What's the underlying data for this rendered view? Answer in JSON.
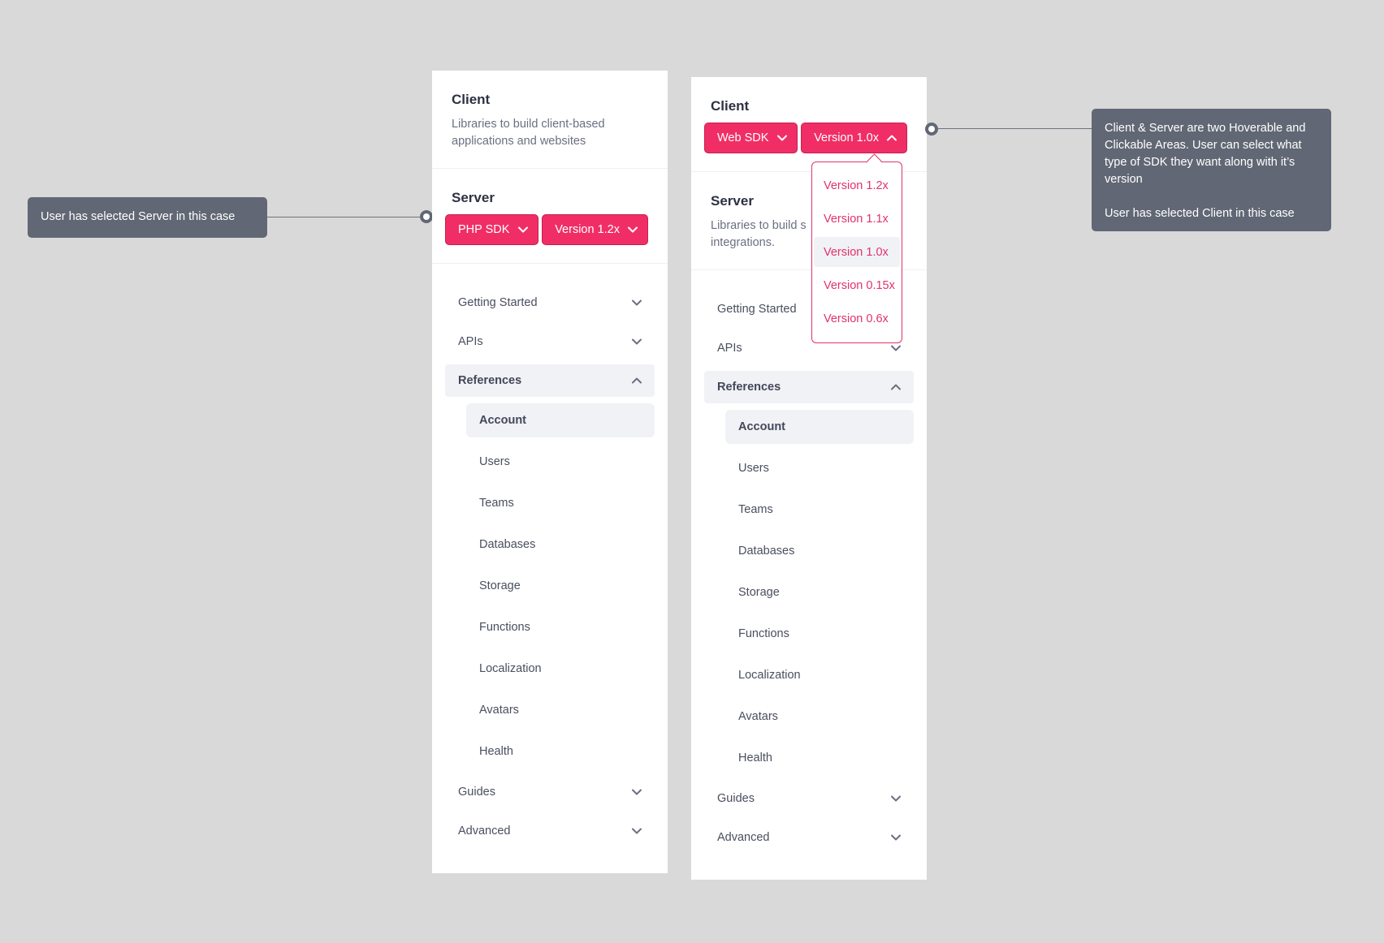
{
  "panels": {
    "server_selected": {
      "client": {
        "title": "Client",
        "description": "Libraries to build client-based applications and websites"
      },
      "server": {
        "title": "Server",
        "sdk_label": "PHP SDK",
        "version_label": "Version 1.2x"
      },
      "nav": {
        "getting_started": "Getting Started",
        "apis": "APIs",
        "references": "References",
        "references_items": [
          "Account",
          "Users",
          "Teams",
          "Databases",
          "Storage",
          "Functions",
          "Localization",
          "Avatars",
          "Health"
        ],
        "guides": "Guides",
        "advanced": "Advanced"
      }
    },
    "client_selected": {
      "client": {
        "title": "Client",
        "sdk_label": "Web SDK",
        "version_label": "Version 1.0x"
      },
      "server": {
        "title": "Server",
        "description_line1": "Libraries to build s",
        "description_line2": "integrations."
      },
      "nav": {
        "getting_started": "Getting Started",
        "apis": "APIs",
        "references": "References",
        "references_items": [
          "Account",
          "Users",
          "Teams",
          "Databases",
          "Storage",
          "Functions",
          "Localization",
          "Avatars",
          "Health"
        ],
        "guides": "Guides",
        "advanced": "Advanced"
      },
      "version_dropdown": {
        "options": [
          "Version 1.2x",
          "Version 1.1x",
          "Version 1.0x",
          "Version 0.15x",
          "Version 0.6x"
        ],
        "selected": "Version 1.0x"
      }
    }
  },
  "annotations": {
    "left": "User has selected Server in this case",
    "right_line1": "Client & Server are two Hoverable and Clickable Areas. User can select what type of SDK they want along with it’s version",
    "right_line2": "User has selected Client in this case"
  },
  "colors": {
    "accent": "#f02e65",
    "background": "#d9d9d9",
    "note_bg": "#616774",
    "active_bg": "#f1f2f6"
  },
  "icons": {
    "collapsed": "chevron-down-icon",
    "expanded": "chevron-up-icon"
  }
}
